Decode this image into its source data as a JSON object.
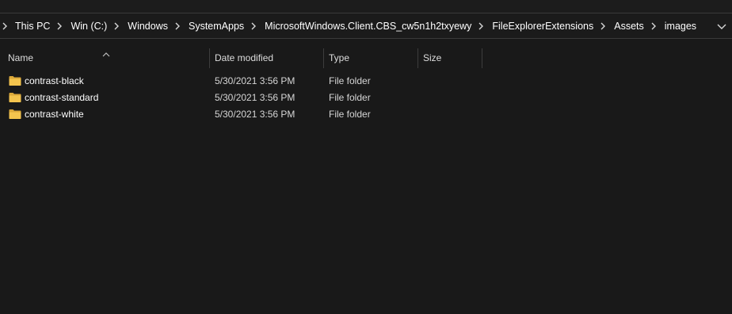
{
  "breadcrumb": {
    "items": [
      {
        "label": "This PC"
      },
      {
        "label": "Win (C:)"
      },
      {
        "label": "Windows"
      },
      {
        "label": "SystemApps"
      },
      {
        "label": "MicrosoftWindows.Client.CBS_cw5n1h2txyewy"
      },
      {
        "label": "FileExplorerExtensions"
      },
      {
        "label": "Assets"
      },
      {
        "label": "images"
      }
    ]
  },
  "columns": {
    "name": "Name",
    "date": "Date modified",
    "type": "Type",
    "size": "Size"
  },
  "sort": {
    "column": "name",
    "direction": "ascending"
  },
  "files": [
    {
      "name": "contrast-black",
      "date": "5/30/2021 3:56 PM",
      "type": "File folder",
      "size": ""
    },
    {
      "name": "contrast-standard",
      "date": "5/30/2021 3:56 PM",
      "type": "File folder",
      "size": ""
    },
    {
      "name": "contrast-white",
      "date": "5/30/2021 3:56 PM",
      "type": "File folder",
      "size": ""
    }
  ],
  "colors": {
    "background": "#191919",
    "folder": "#f4c44e",
    "folder_dark": "#dca93a"
  },
  "icons": {
    "folder": "folder-icon",
    "chevron": "chevron-right-icon",
    "dropdown": "chevron-down-icon",
    "sort": "sort-ascending-icon"
  }
}
